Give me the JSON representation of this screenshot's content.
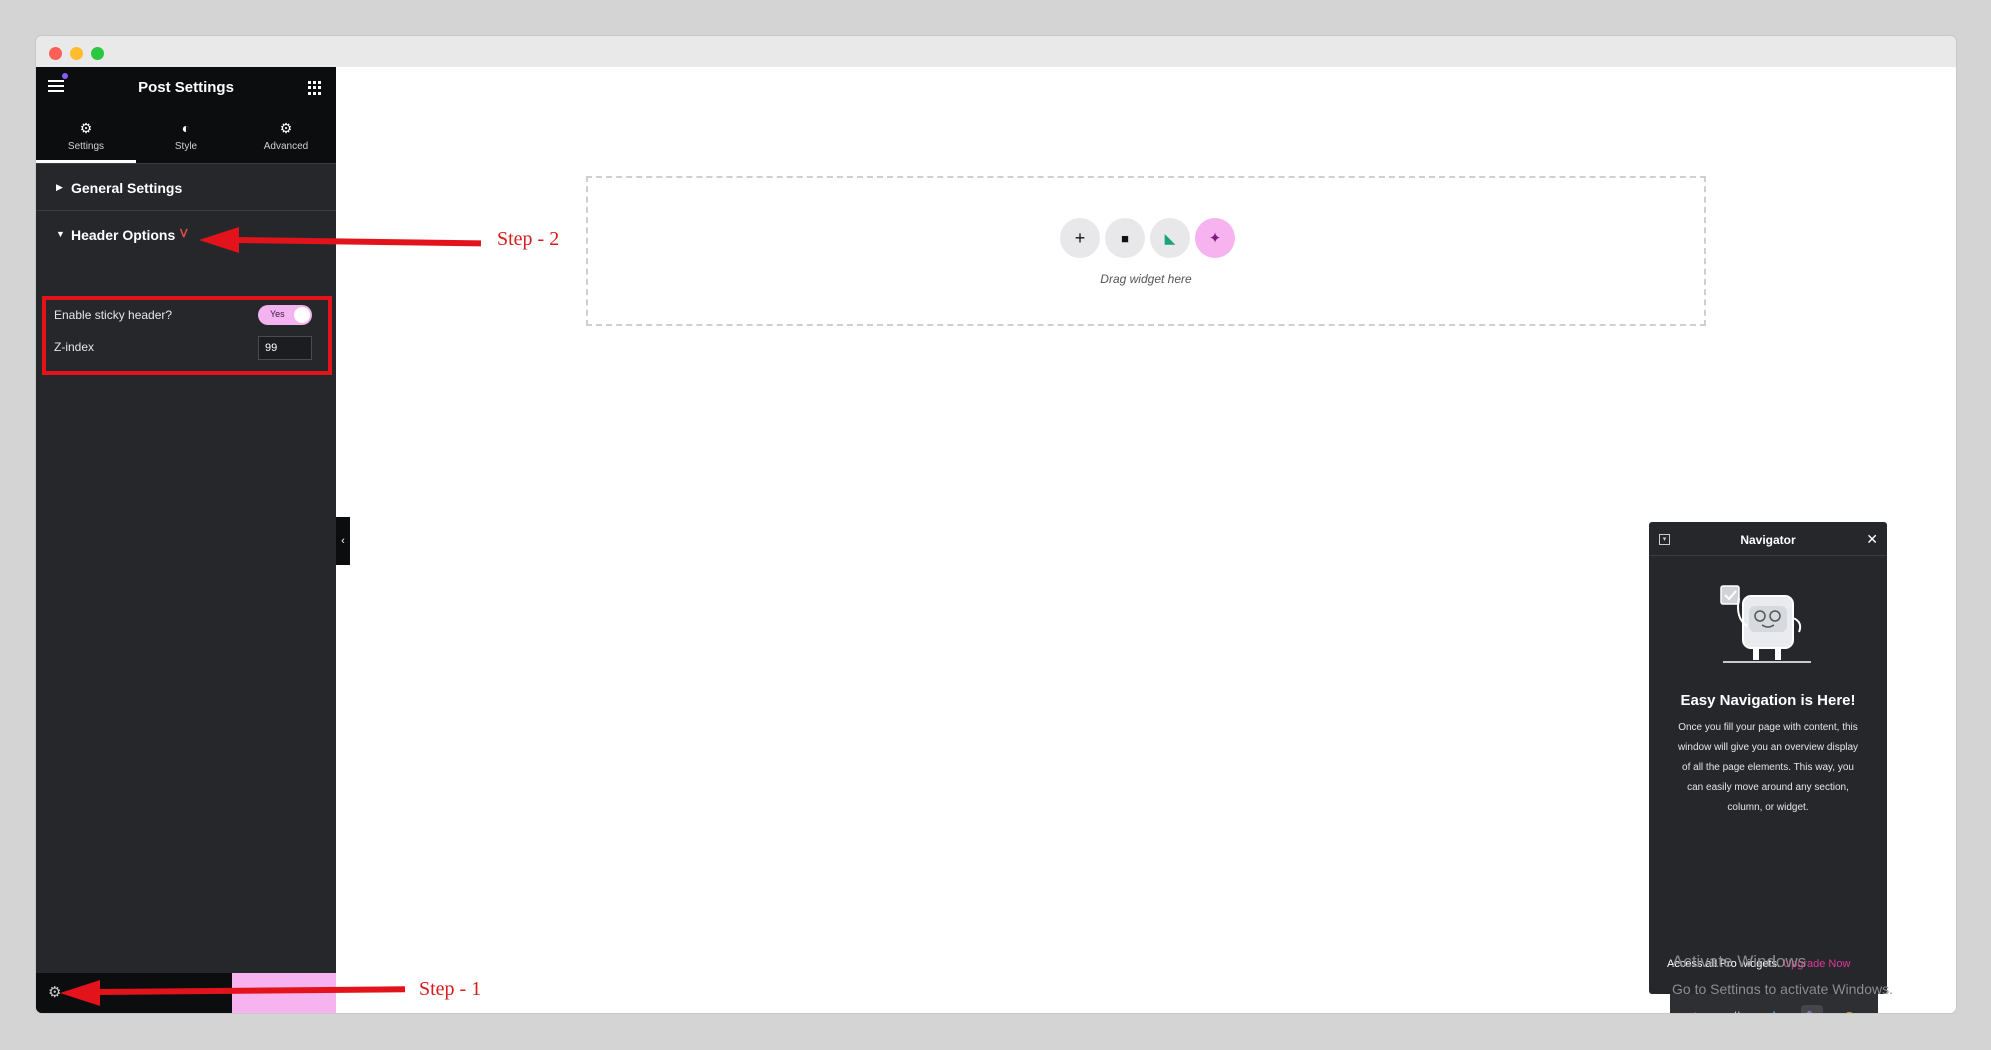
{
  "sidebar": {
    "title": "Post Settings",
    "tabs": [
      {
        "label": "Settings",
        "icon": "gear-icon"
      },
      {
        "label": "Style",
        "icon": "contrast-icon"
      },
      {
        "label": "Advanced",
        "icon": "advanced-gear-icon"
      }
    ],
    "sections": [
      {
        "title": "General Settings"
      },
      {
        "title": "Header Options"
      }
    ],
    "controls": {
      "sticky_label": "Enable sticky header?",
      "sticky_value": "Yes",
      "zindex_label": "Z-index",
      "zindex_value": "99"
    }
  },
  "canvas": {
    "drag_text": "Drag widget here"
  },
  "annotations": {
    "step1": "Step - 1",
    "step2": "Step - 2"
  },
  "navigator": {
    "title": "Navigator",
    "heading": "Easy Navigation is Here!",
    "body": "Once you fill your page with content, this window will give you an overview display of all the page elements. This way, you can easily move around any section, column, or widget.",
    "footer_text": "Access all Pro widgets.",
    "footer_link": "Upgrade Now"
  },
  "watermark": {
    "line1": "Activate Windows",
    "line2": "Go to Settings to activate Windows."
  },
  "colors": {
    "sidebar_bg": "#26272b",
    "accent_pink": "#f7b3ef",
    "annotation_red": "#e3131b"
  }
}
